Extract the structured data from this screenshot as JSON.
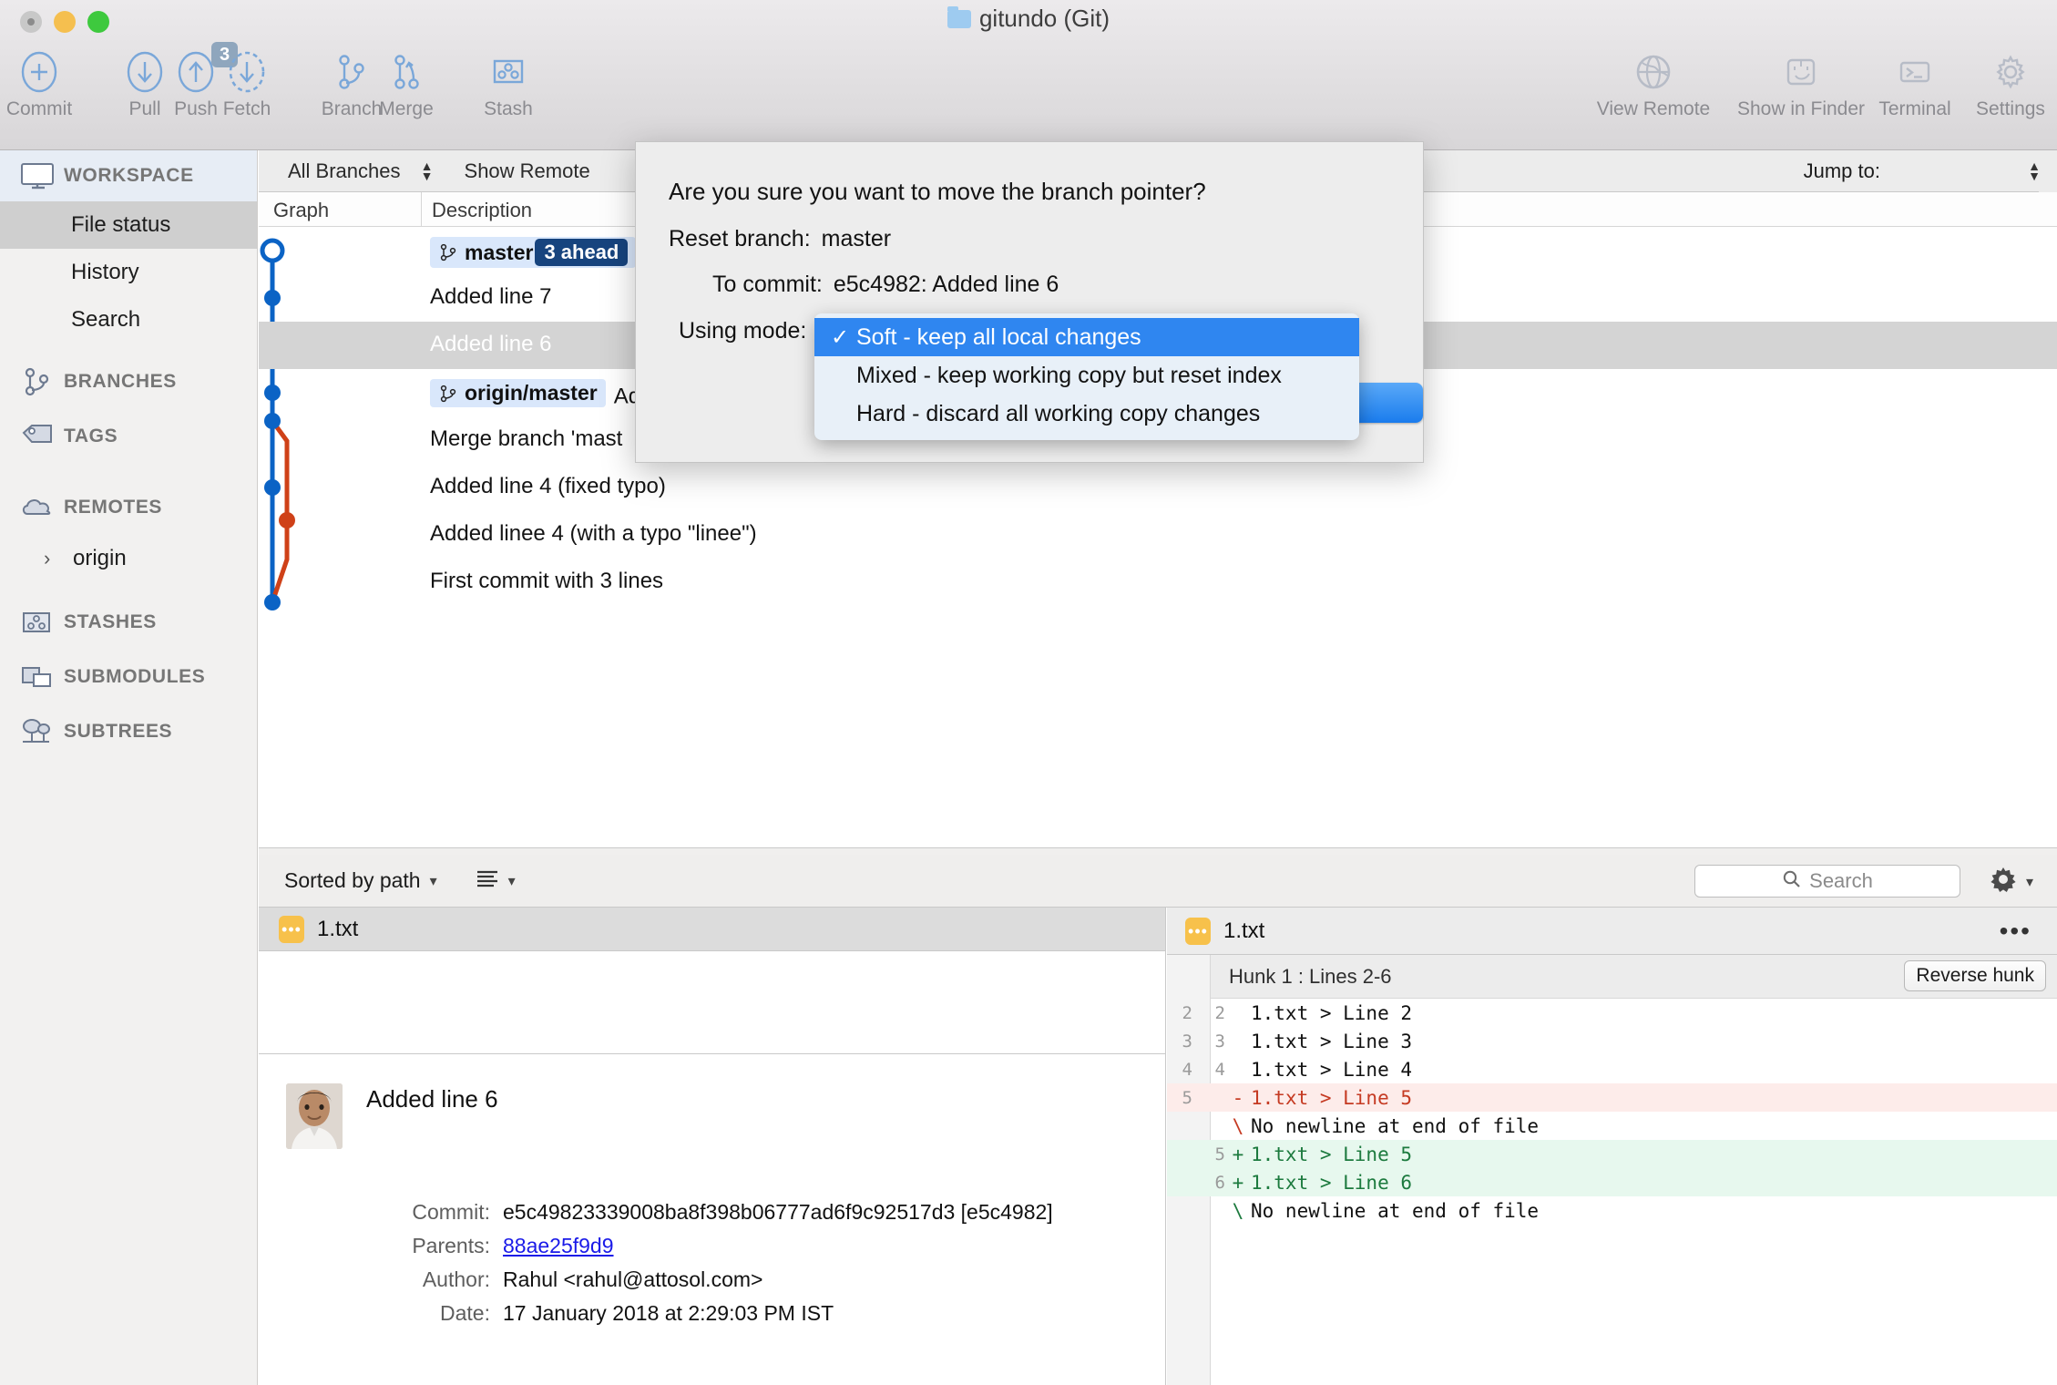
{
  "window": {
    "title": "gitundo (Git)",
    "folder_icon": "folder-icon",
    "traffic": {
      "close": "close-window-button",
      "minimize": "minimize-window-button",
      "zoom": "zoom-window-button"
    }
  },
  "toolbar": {
    "items": [
      {
        "label": "Commit",
        "icon": "plus-circle-icon",
        "badge": ""
      },
      {
        "label": "Pull",
        "icon": "arrow-down-circle-icon",
        "badge": ""
      },
      {
        "label": "Push",
        "icon": "arrow-up-circle-icon",
        "badge": "3"
      },
      {
        "label": "Fetch",
        "icon": "arrow-down-dashed-circle-icon",
        "badge": ""
      },
      {
        "label": "Branch",
        "icon": "branch-icon",
        "badge": ""
      },
      {
        "label": "Merge",
        "icon": "merge-icon",
        "badge": ""
      },
      {
        "label": "Stash",
        "icon": "stash-icon",
        "badge": ""
      },
      {
        "label": "View Remote",
        "icon": "globe-icon",
        "badge": ""
      },
      {
        "label": "Show in Finder",
        "icon": "finder-icon",
        "badge": ""
      },
      {
        "label": "Terminal",
        "icon": "terminal-icon",
        "badge": ""
      },
      {
        "label": "Settings",
        "icon": "gear-icon",
        "badge": ""
      }
    ]
  },
  "sidebar": {
    "workspace": {
      "label": "WORKSPACE",
      "icon": "monitor-icon"
    },
    "workspace_items": [
      {
        "label": "File status",
        "active": true
      },
      {
        "label": "History",
        "active": false
      },
      {
        "label": "Search",
        "active": false
      }
    ],
    "groups": [
      {
        "label": "BRANCHES",
        "icon": "branch-icon"
      },
      {
        "label": "TAGS",
        "icon": "tag-icon"
      },
      {
        "label": "REMOTES",
        "icon": "cloud-icon"
      }
    ],
    "remotes": [
      {
        "label": "origin",
        "icon": "chevron-right-icon"
      }
    ],
    "groups_after": [
      {
        "label": "STASHES",
        "icon": "stash-icon"
      },
      {
        "label": "SUBMODULES",
        "icon": "submodules-icon"
      },
      {
        "label": "SUBTREES",
        "icon": "subtrees-icon"
      }
    ]
  },
  "graph_toolbar": {
    "branch_filter": "All Branches",
    "show_remote": "Show Remote",
    "jump_to_label": "Jump to:"
  },
  "columns": {
    "graph": "Graph",
    "description": "Description"
  },
  "commits": [
    {
      "desc": "",
      "refs": [
        {
          "name": "master",
          "ahead": "3 ahead"
        }
      ],
      "selected": false
    },
    {
      "desc": "Added line 7",
      "refs": [],
      "selected": false
    },
    {
      "desc": "Added line 6",
      "refs": [],
      "selected": true
    },
    {
      "desc": "Add",
      "refs": [
        {
          "name": "origin/master",
          "ahead": ""
        }
      ],
      "selected": false
    },
    {
      "desc": "Merge branch 'mast",
      "refs": [],
      "selected": false
    },
    {
      "desc": "Added line 4 (fixed typo)",
      "refs": [],
      "selected": false
    },
    {
      "desc": "Added linee 4 (with a typo \"linee\")",
      "refs": [],
      "selected": false
    },
    {
      "desc": "First commit with 3 lines",
      "refs": [],
      "selected": false
    }
  ],
  "bottom_toolbar": {
    "sort_label": "Sorted by path",
    "list_view_icon": "list-view-icon",
    "search_placeholder": "Search",
    "search_value": "",
    "gear_icon": "gear-icon"
  },
  "file_panel": {
    "file_name": "1.txt",
    "file_status_icon": "modified-file-icon"
  },
  "commit_detail": {
    "title": "Added line 6",
    "avatar": "author-avatar",
    "fields": [
      {
        "key": "Commit:",
        "value": "e5c49823339008ba8f398b06777ad6f9c92517d3 [e5c4982]",
        "link": false
      },
      {
        "key": "Parents:",
        "value": "88ae25f9d9",
        "link": true
      },
      {
        "key": "Author:",
        "value": "Rahul <rahul@attosol.com>",
        "link": false
      },
      {
        "key": "Date:",
        "value": "17 January 2018 at 2:29:03 PM IST",
        "link": false
      }
    ]
  },
  "diff_panel": {
    "file_name": "1.txt",
    "file_status_icon": "modified-file-icon",
    "more_icon": "more-options-icon",
    "hunk_label": "Hunk 1 : Lines 2-6",
    "reverse_button": "Reverse hunk",
    "lines": [
      {
        "old": "2",
        "new": "2",
        "sign": "",
        "text": "1.txt > Line 2",
        "type": "ctx"
      },
      {
        "old": "3",
        "new": "3",
        "sign": "",
        "text": "1.txt > Line 3",
        "type": "ctx"
      },
      {
        "old": "4",
        "new": "4",
        "sign": "",
        "text": "1.txt > Line 4",
        "type": "ctx"
      },
      {
        "old": "5",
        "new": "",
        "sign": "-",
        "text": "1.txt > Line 5",
        "type": "del"
      },
      {
        "old": "",
        "new": "",
        "sign": "\\",
        "text": "No newline at end of file",
        "type": "nonl"
      },
      {
        "old": "",
        "new": "5",
        "sign": "+",
        "text": "1.txt > Line 5",
        "type": "add"
      },
      {
        "old": "",
        "new": "6",
        "sign": "+",
        "text": "1.txt > Line 6",
        "type": "add"
      },
      {
        "old": "",
        "new": "",
        "sign": "\\",
        "text": "No newline at end of file",
        "type": "nonl green"
      }
    ]
  },
  "modal": {
    "title": "Are you sure you want to move the branch pointer?",
    "reset_branch_label": "Reset branch:",
    "reset_branch_value": "master",
    "to_commit_label": "To commit:",
    "to_commit_value": "e5c4982: Added line 6",
    "using_mode_label": "Using mode:",
    "ok_button": "",
    "dropdown": {
      "selected_index": 0,
      "options": [
        "Soft - keep all local changes",
        "Mixed - keep working copy but reset index",
        "Hard - discard all working copy changes"
      ],
      "check_glyph": "✓"
    }
  },
  "colors": {
    "accent_blue": "#1a7ced",
    "graph_blue": "#0b63c5",
    "graph_orange": "#cf4118",
    "ref_pill": "#d9e7fb",
    "ahead_pill": "#17447e",
    "diff_add": "#e7f8ee",
    "diff_del": "#fdecea",
    "file_badge": "#f7c14b"
  }
}
